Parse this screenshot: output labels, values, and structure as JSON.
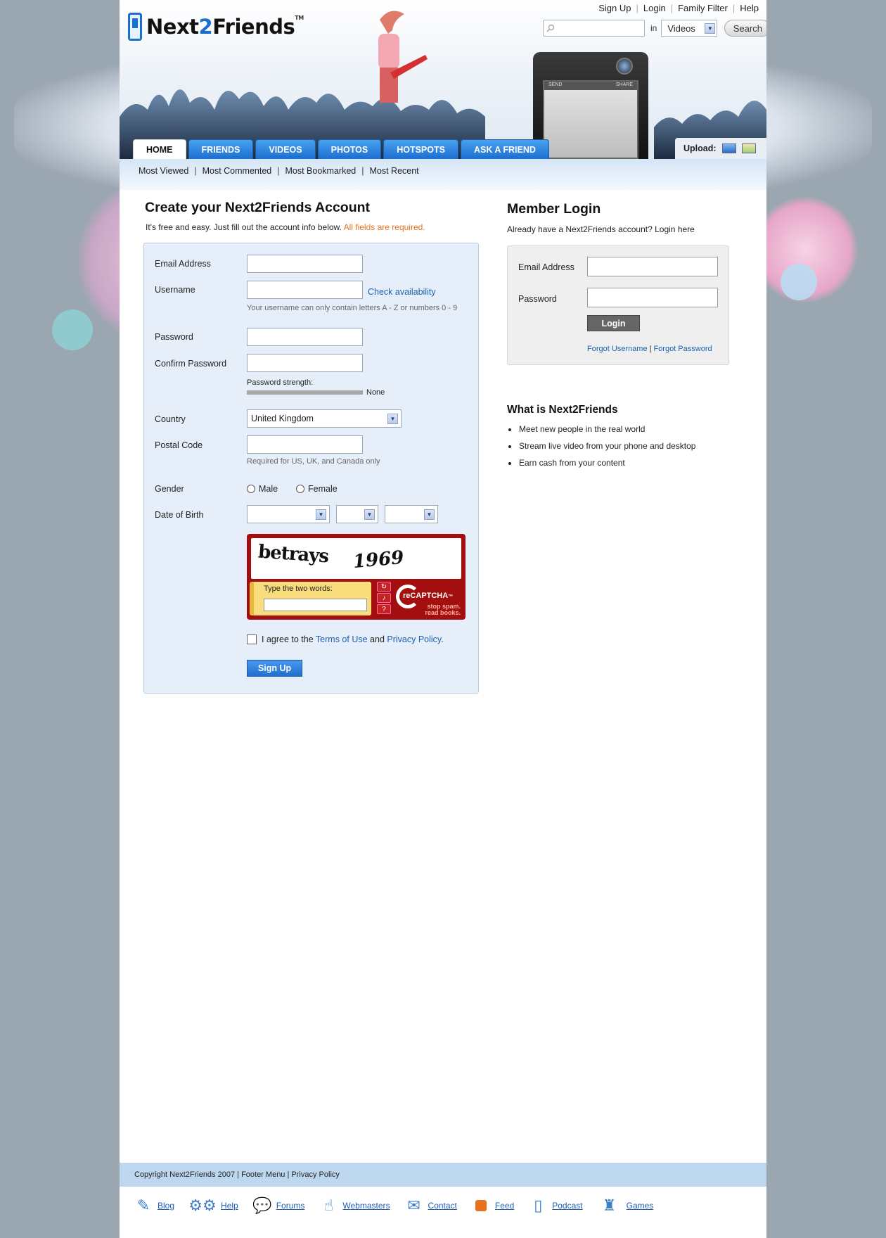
{
  "brand": {
    "logo_text_a": "Next",
    "logo_text_b": "2",
    "logo_text_c": "Friends",
    "logo_tm": "TM"
  },
  "top_links": [
    "Sign Up",
    "Login",
    "Family Filter",
    "Help"
  ],
  "search": {
    "placeholder": "",
    "in_label": "in",
    "scope_selected": "Videos",
    "button_label": "Search"
  },
  "phone_screen": {
    "left_label": "SEND",
    "right_label": "SHARE"
  },
  "nav": {
    "tabs": [
      "HOME",
      "FRIENDS",
      "VIDEOS",
      "PHOTOS",
      "HOTSPOTS",
      "ASK A FRIEND"
    ],
    "active_tab": "HOME",
    "upload_label": "Upload:"
  },
  "subnav": [
    "Most Viewed",
    "Most Commented",
    "Most Bookmarked",
    "Most Recent"
  ],
  "signup": {
    "title": "Create your Next2Friends Account",
    "intro": "It's free and easy. Just fill out the account info below.",
    "required_note": "All fields are required.",
    "email_label": "Email Address",
    "username_label": "Username",
    "check_availability": "Check availability",
    "username_hint": "Your username can only contain letters A - Z or numbers 0 - 9",
    "password_label": "Password",
    "confirm_label": "Confirm Password",
    "strength_label": "Password strength:",
    "strength_value": "None",
    "country_label": "Country",
    "country_value": "United Kingdom",
    "postal_label": "Postal Code",
    "postal_hint": "Required for US, UK, and Canada only",
    "gender_label": "Gender",
    "gender_male": "Male",
    "gender_female": "Female",
    "dob_label": "Date of Birth",
    "captcha_word1": "betrays",
    "captcha_word2": "1969",
    "captcha_prompt": "Type the two words:",
    "recaptcha_brand": "reCAPTCHA",
    "recaptcha_tm": "™",
    "recaptcha_slogan_a": "stop spam.",
    "recaptcha_slogan_b": "read books.",
    "agree_prefix": "I agree to the",
    "terms_link": "Terms of Use",
    "agree_and": "and",
    "privacy_link": "Privacy Policy",
    "agree_suffix": ".",
    "submit_label": "Sign Up"
  },
  "login": {
    "title": "Member Login",
    "intro": "Already have a Next2Friends account? Login here",
    "email_label": "Email Address",
    "password_label": "Password",
    "button_label": "Login",
    "forgot_username": "Forgot Username",
    "forgot_password": "Forgot Password",
    "forgot_sep": "|"
  },
  "about": {
    "title": "What is Next2Friends",
    "items": [
      "Meet new people in the real world",
      "Stream live video from your phone and desktop",
      "Earn cash from your content"
    ]
  },
  "footer": {
    "copyright": "Copyright Next2Friends 2007",
    "sep": "|",
    "footer_menu": "Footer Menu",
    "privacy": "Privacy Policy",
    "links": [
      {
        "label": "Blog",
        "icon": "blog-icon"
      },
      {
        "label": "Help",
        "icon": "help-gears-icon"
      },
      {
        "label": "Forums",
        "icon": "forums-bubble-icon"
      },
      {
        "label": "Webmasters",
        "icon": "webmasters-cursor-icon"
      },
      {
        "label": "Contact",
        "icon": "contact-envelope-icon"
      },
      {
        "label": "Feed",
        "icon": "rss-feed-icon"
      },
      {
        "label": "Podcast",
        "icon": "podcast-ipod-icon"
      },
      {
        "label": "Games",
        "icon": "games-joystick-icon"
      }
    ]
  },
  "colors": {
    "nav_blue": "#1b6fd1",
    "link_blue": "#1d5fb4",
    "required_orange": "#e8731f",
    "recaptcha_red": "#a30f0f",
    "page_bg": "#9aa6b0",
    "footer_bar": "#bcd7ee"
  }
}
